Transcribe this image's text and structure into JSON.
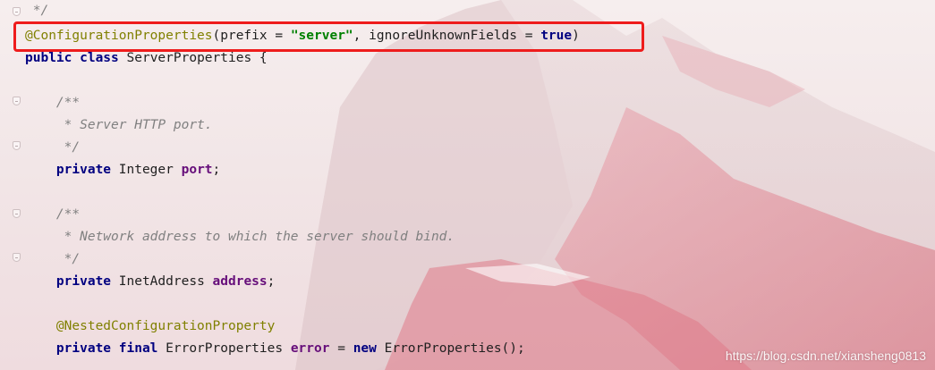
{
  "editor": {
    "lines": [
      {
        "tokens": [
          {
            "t": "cm",
            "v": " */"
          }
        ]
      },
      {
        "tokens": [
          {
            "t": "an",
            "v": "@ConfigurationProperties"
          },
          {
            "t": "p",
            "v": "(prefix = "
          },
          {
            "t": "str",
            "v": "\"server\""
          },
          {
            "t": "p",
            "v": ", ignoreUnknownFields = "
          },
          {
            "t": "kw",
            "v": "true"
          },
          {
            "t": "p",
            "v": ")"
          }
        ]
      },
      {
        "tokens": [
          {
            "t": "kw",
            "v": "public class "
          },
          {
            "t": "p",
            "v": "ServerProperties {"
          }
        ]
      },
      {
        "tokens": []
      },
      {
        "tokens": [
          {
            "t": "cm",
            "v": "    /**"
          }
        ]
      },
      {
        "tokens": [
          {
            "t": "cm",
            "v": "     * Server HTTP port."
          }
        ]
      },
      {
        "tokens": [
          {
            "t": "cm",
            "v": "     */"
          }
        ]
      },
      {
        "tokens": [
          {
            "t": "p",
            "v": "    "
          },
          {
            "t": "kw",
            "v": "private "
          },
          {
            "t": "p",
            "v": "Integer "
          },
          {
            "t": "fld",
            "v": "port"
          },
          {
            "t": "p",
            "v": ";"
          }
        ]
      },
      {
        "tokens": []
      },
      {
        "tokens": [
          {
            "t": "cm",
            "v": "    /**"
          }
        ]
      },
      {
        "tokens": [
          {
            "t": "cm",
            "v": "     * Network address to which the server should bind."
          }
        ]
      },
      {
        "tokens": [
          {
            "t": "cm",
            "v": "     */"
          }
        ]
      },
      {
        "tokens": [
          {
            "t": "p",
            "v": "    "
          },
          {
            "t": "kw",
            "v": "private "
          },
          {
            "t": "p",
            "v": "InetAddress "
          },
          {
            "t": "fld",
            "v": "address"
          },
          {
            "t": "p",
            "v": ";"
          }
        ]
      },
      {
        "tokens": []
      },
      {
        "tokens": [
          {
            "t": "an",
            "v": "    @NestedConfigurationProperty"
          }
        ]
      },
      {
        "tokens": [
          {
            "t": "p",
            "v": "    "
          },
          {
            "t": "kw",
            "v": "private final "
          },
          {
            "t": "p",
            "v": "ErrorProperties "
          },
          {
            "t": "fld",
            "v": "error"
          },
          {
            "t": "p",
            "v": " = "
          },
          {
            "t": "kw",
            "v": "new "
          },
          {
            "t": "p",
            "v": "ErrorProperties();"
          }
        ]
      }
    ],
    "highlight_line_index": 1
  },
  "watermark": "https://blog.csdn.net/xiansheng0813",
  "colors": {
    "keyword": "#000080",
    "comment": "#808080",
    "annotation": "#808000",
    "string": "#008000",
    "field": "#660e7a",
    "highlight_box": "#ee1c1c"
  }
}
